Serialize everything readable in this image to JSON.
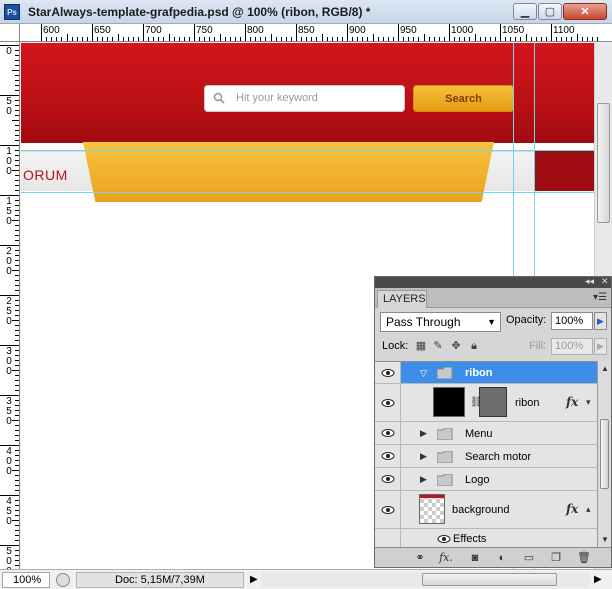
{
  "window": {
    "title": "StarAlways-template-grafpedia.psd @ 100% (ribon, RGB/8) *",
    "app_icon": "Ps",
    "minimize": "▁",
    "maximize": "▢",
    "close": "✕"
  },
  "ruler": {
    "top_labels": [
      "600",
      "650",
      "700",
      "750",
      "800",
      "850",
      "900",
      "950",
      "1000",
      "1050",
      "1100"
    ],
    "left_labels": [
      "0",
      "5\n0",
      "1\n0\n0",
      "1\n5\n0",
      "2\n0\n0",
      "2\n5\n0",
      "3\n0\n0",
      "3\n5\n0",
      "4\n0\n0",
      "4\n5\n0",
      "5\n0\n0"
    ]
  },
  "canvas": {
    "search_placeholder": "Hit your keyword",
    "search_button": "Search",
    "nav_partial_label": "ORUM",
    "colors": {
      "header_red": "#c8121a",
      "ribbon_orange": "#f2b233",
      "guide": "#6fd6e6"
    }
  },
  "status": {
    "zoom": "100%",
    "doc": "Doc: 5,15M/7,39M"
  },
  "layers_panel": {
    "tab": "LAYERS",
    "blend_mode": "Pass Through",
    "opacity_label": "Opacity:",
    "opacity": "100%",
    "lock_label": "Lock:",
    "fill_label": "Fill:",
    "fill": "100%",
    "layers": [
      {
        "name": "ribon",
        "type": "group",
        "expanded": true,
        "selected": true
      },
      {
        "name": "ribon",
        "type": "layer",
        "has_mask": true,
        "has_fx": true
      },
      {
        "name": "Menu",
        "type": "group",
        "expanded": false
      },
      {
        "name": "Search motor",
        "type": "group",
        "expanded": false
      },
      {
        "name": "Logo",
        "type": "group",
        "expanded": false
      },
      {
        "name": "background",
        "type": "layer",
        "has_fx": true
      },
      {
        "name": "Effects",
        "type": "effects"
      }
    ],
    "footer_icons": [
      "link-layers-icon",
      "fx-icon",
      "add-mask-icon",
      "adjustment-layer-icon",
      "new-group-icon",
      "new-layer-icon",
      "trash-icon"
    ]
  }
}
